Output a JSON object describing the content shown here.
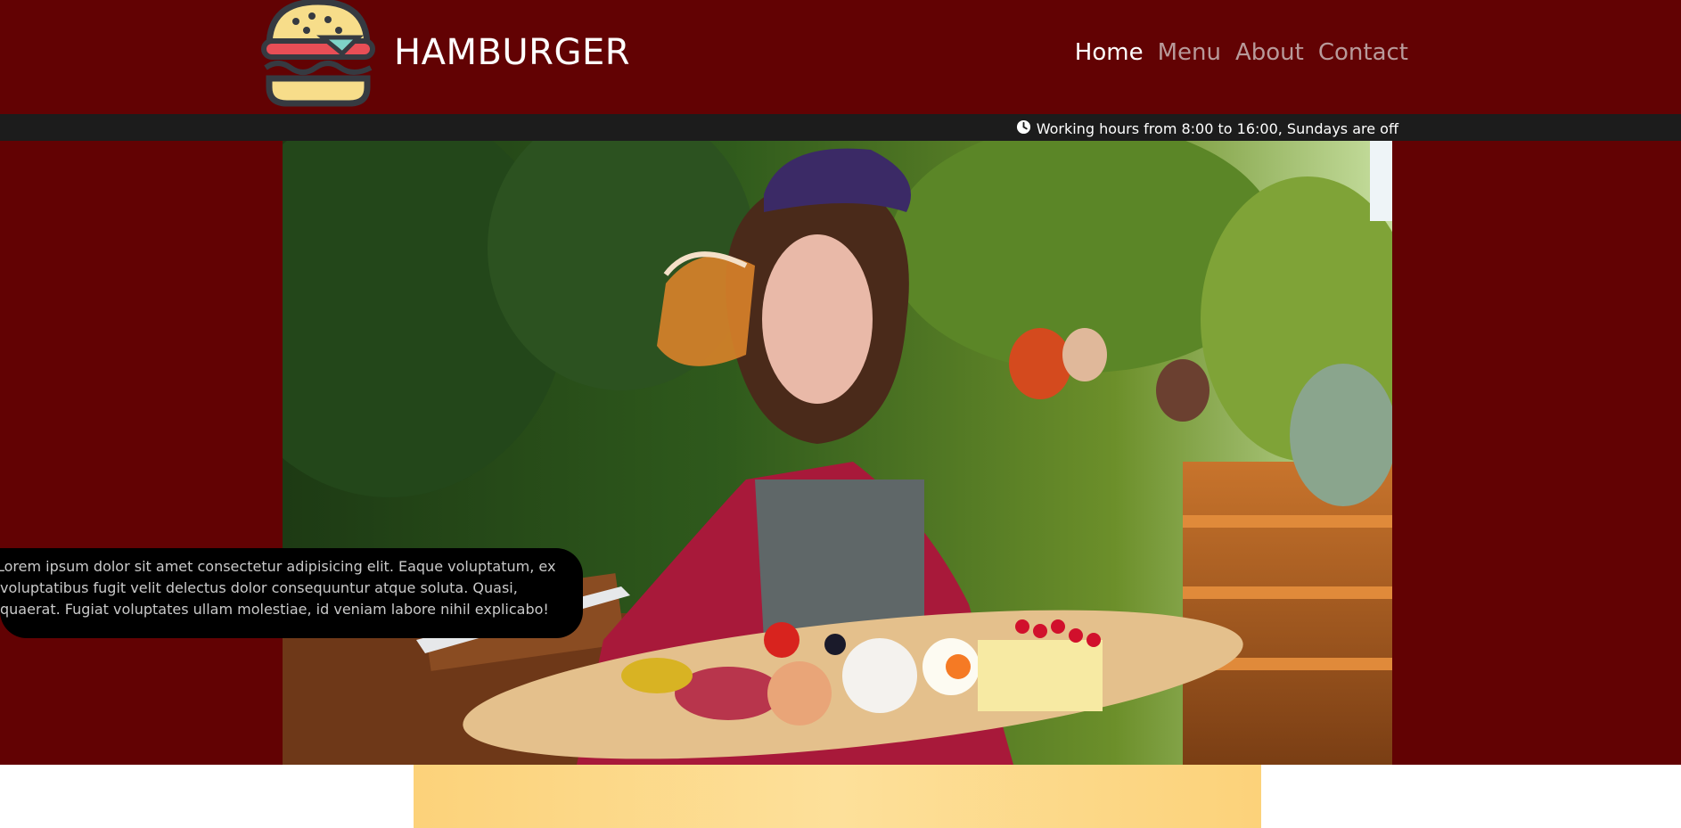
{
  "header": {
    "logo_icon": "hamburger-logo-icon",
    "brand": "HAMBURGER",
    "nav": [
      {
        "label": "Home",
        "active": true
      },
      {
        "label": "Menu",
        "active": false
      },
      {
        "label": "About",
        "active": false
      },
      {
        "label": "Contact",
        "active": false
      }
    ]
  },
  "hours_bar": {
    "icon": "clock-icon",
    "text": "Working hours from 8:00 to 16:00, Sundays are off"
  },
  "hero": {
    "image": "woman-drinking-beer-with-food-platter-photo",
    "caption": "Lorem ipsum dolor sit amet consectetur adipisicing elit. Eaque voluptatum, ex voluptatibus fugit velit delectus dolor consequuntur atque soluta. Quasi, quaerat. Fugiat voluptates ullam molestiae, id veniam labore nihil explicabo!"
  },
  "colors": {
    "header_bg": "#620203",
    "hours_bg": "#1c1c1c",
    "caption_bg": "#000000",
    "nav_active": "#ffffff",
    "nav_inactive": "#b89a9a",
    "yellow_band": "#fcd27a"
  }
}
